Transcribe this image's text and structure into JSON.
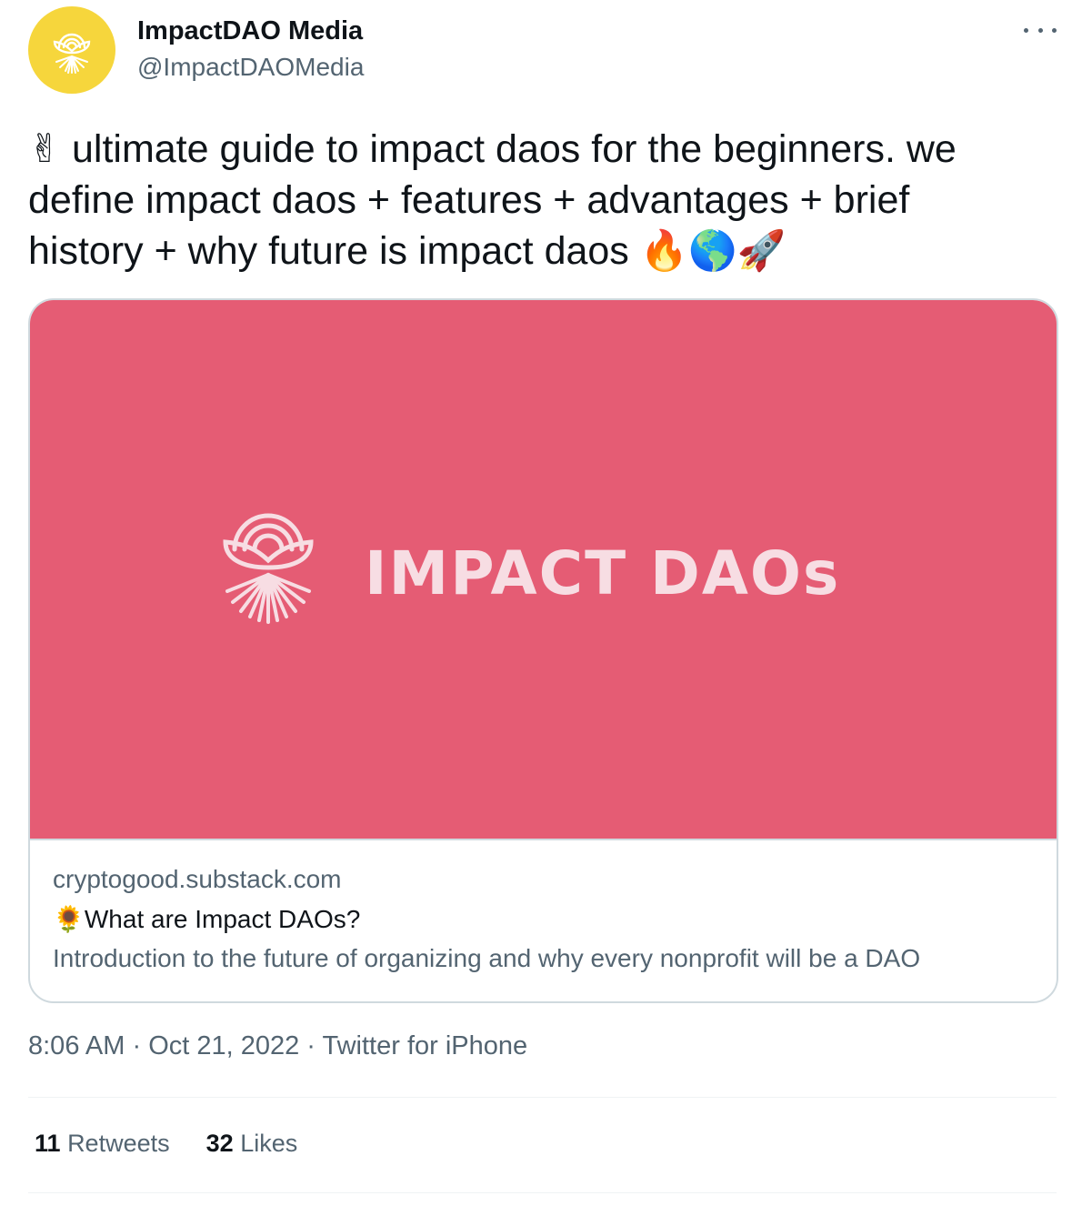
{
  "author": {
    "name": "ImpactDAO Media",
    "handle": "@ImpactDAOMedia",
    "avatar_color": "#f6d63c"
  },
  "more_icon": "more-horizontal-icon",
  "tweet": {
    "text_lines": [
      "ultimate guide to impact daos for the beginners. we",
      "define impact daos + features + advantages + brief",
      "history + why future is impact daos"
    ],
    "lead_emoji": "✌",
    "trail_emojis": [
      "🔥",
      "🌎",
      "🚀"
    ]
  },
  "card": {
    "image_bg": "#e55c74",
    "wordmark": "IMPACT DAOs",
    "domain": "cryptogood.substack.com",
    "title_emoji": "🌻",
    "title": "What are Impact DAOs?",
    "description": "Introduction to the future of organizing and why every nonprofit will be a DAO"
  },
  "meta": {
    "time": "8:06 AM",
    "date": "Oct 21, 2022",
    "source": "Twitter for iPhone",
    "separator": " · "
  },
  "stats": {
    "retweets_count": "11",
    "retweets_label": "Retweets",
    "likes_count": "32",
    "likes_label": "Likes"
  }
}
